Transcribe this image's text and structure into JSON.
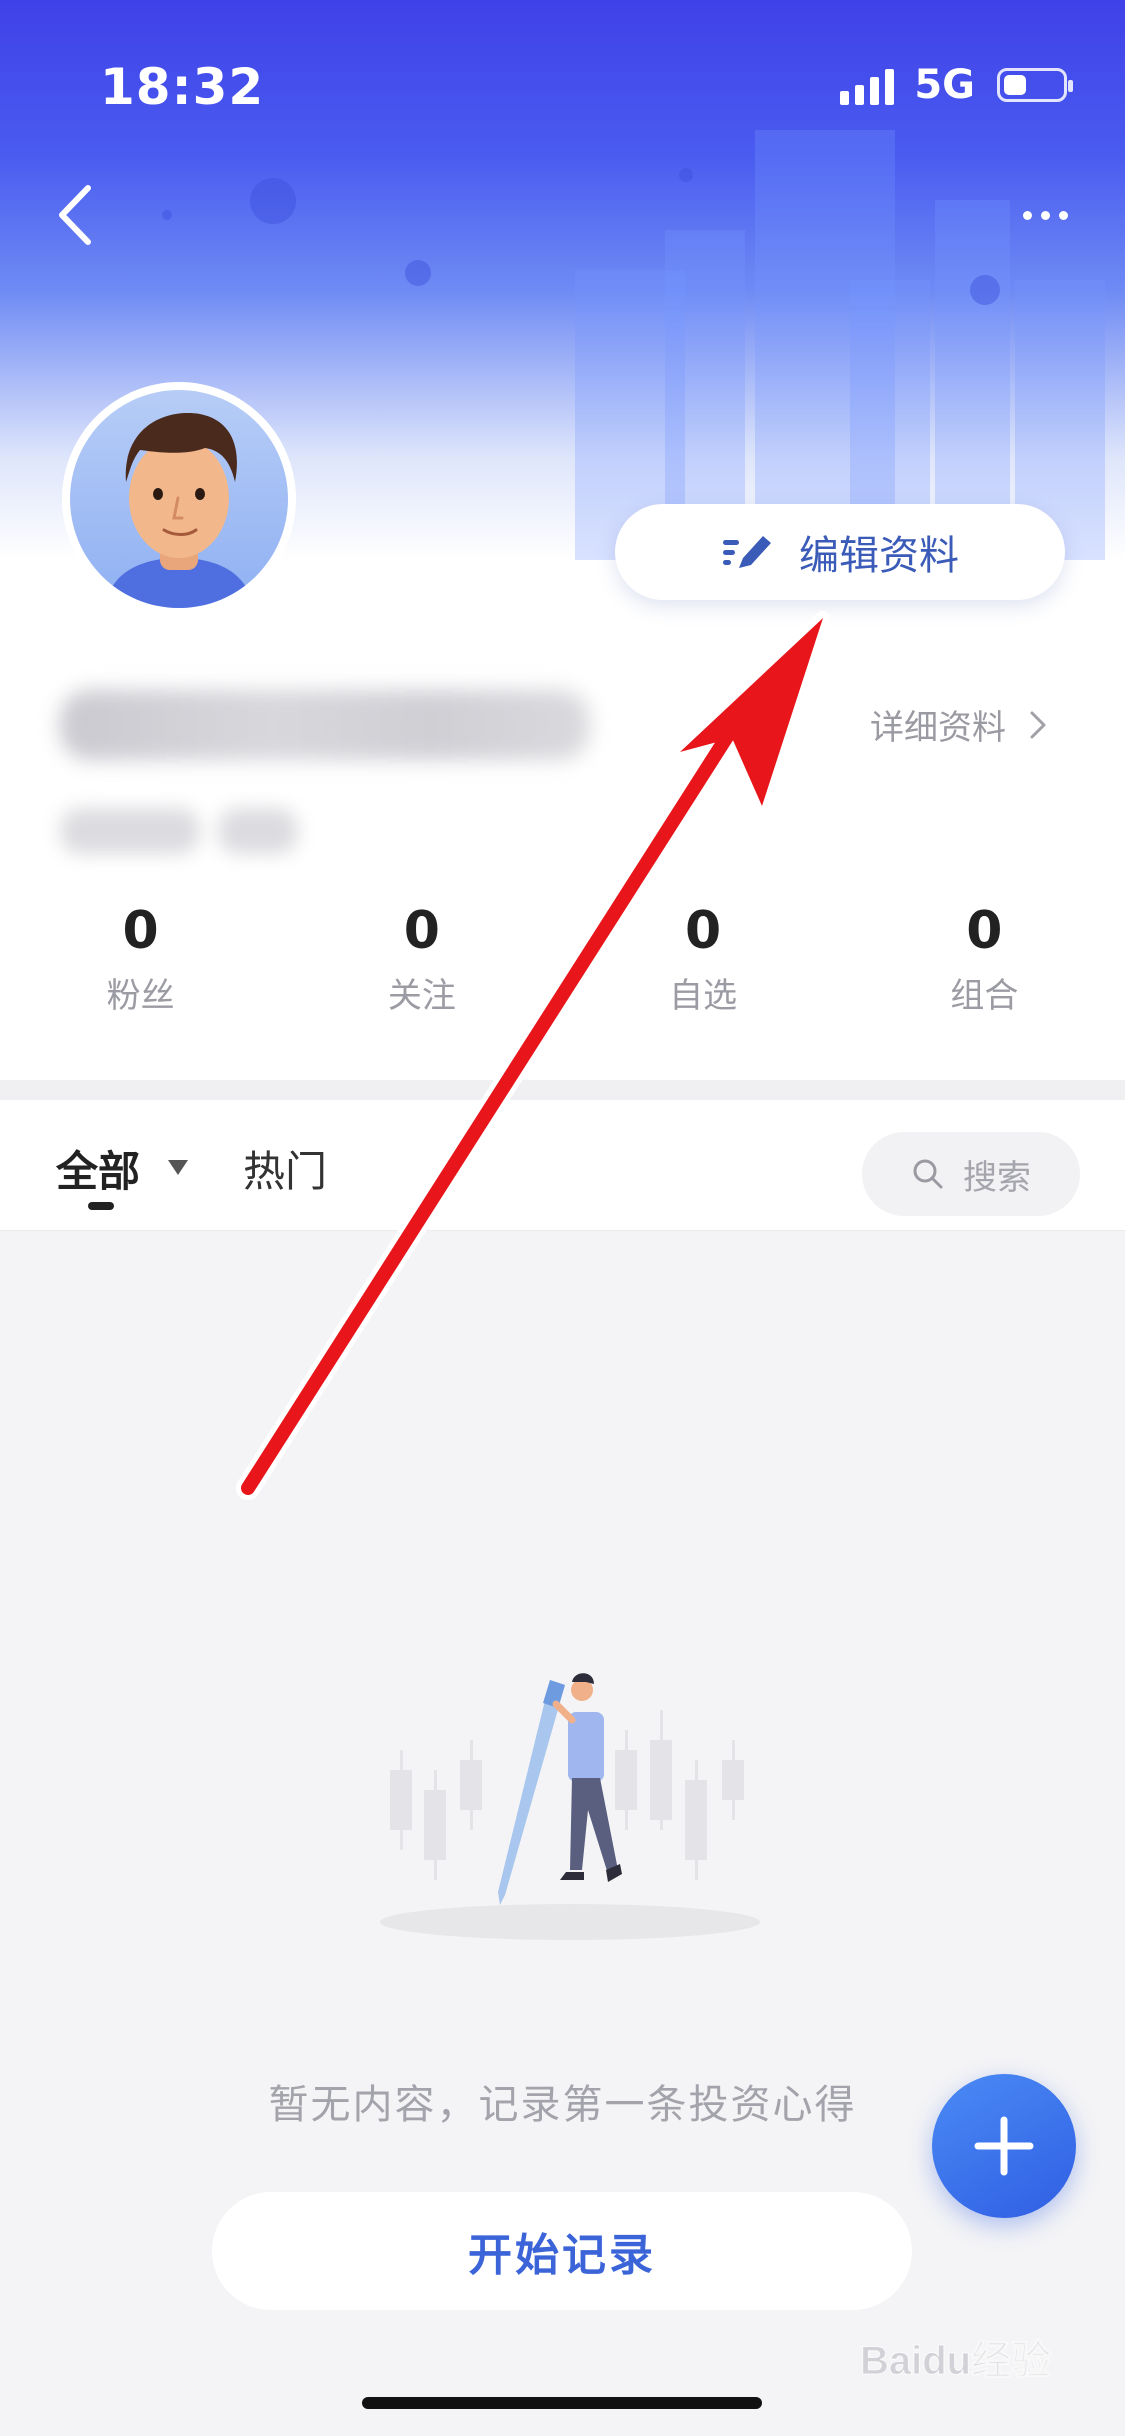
{
  "status_bar": {
    "time": "18:32",
    "network": "5G",
    "battery_level": 0.4
  },
  "header": {
    "back_icon": "chevron-left-icon",
    "more_icon": "more-horizontal-icon"
  },
  "profile": {
    "avatar_icon": "avatar-illustration",
    "edit_button_label": "编辑资料",
    "edit_icon": "edit-lines-icon",
    "detail_link_label": "详细资料",
    "detail_chevron_icon": "chevron-right-icon"
  },
  "stats": [
    {
      "value": "0",
      "label": "粉丝"
    },
    {
      "value": "0",
      "label": "关注"
    },
    {
      "value": "0",
      "label": "自选"
    },
    {
      "value": "0",
      "label": "组合"
    }
  ],
  "tabs": {
    "all_label": "全部",
    "hot_label": "热门"
  },
  "search": {
    "placeholder": "搜索"
  },
  "empty_state": {
    "text": "暂无内容，记录第一条投资心得",
    "button_label": "开始记录"
  },
  "fab": {
    "icon": "plus-icon"
  },
  "watermark": {
    "text": "Baidu经验"
  },
  "annotation": {
    "color": "#e8161b"
  },
  "colors": {
    "brand_blue": "#3f41e8",
    "accent_blue": "#3a64d8"
  }
}
